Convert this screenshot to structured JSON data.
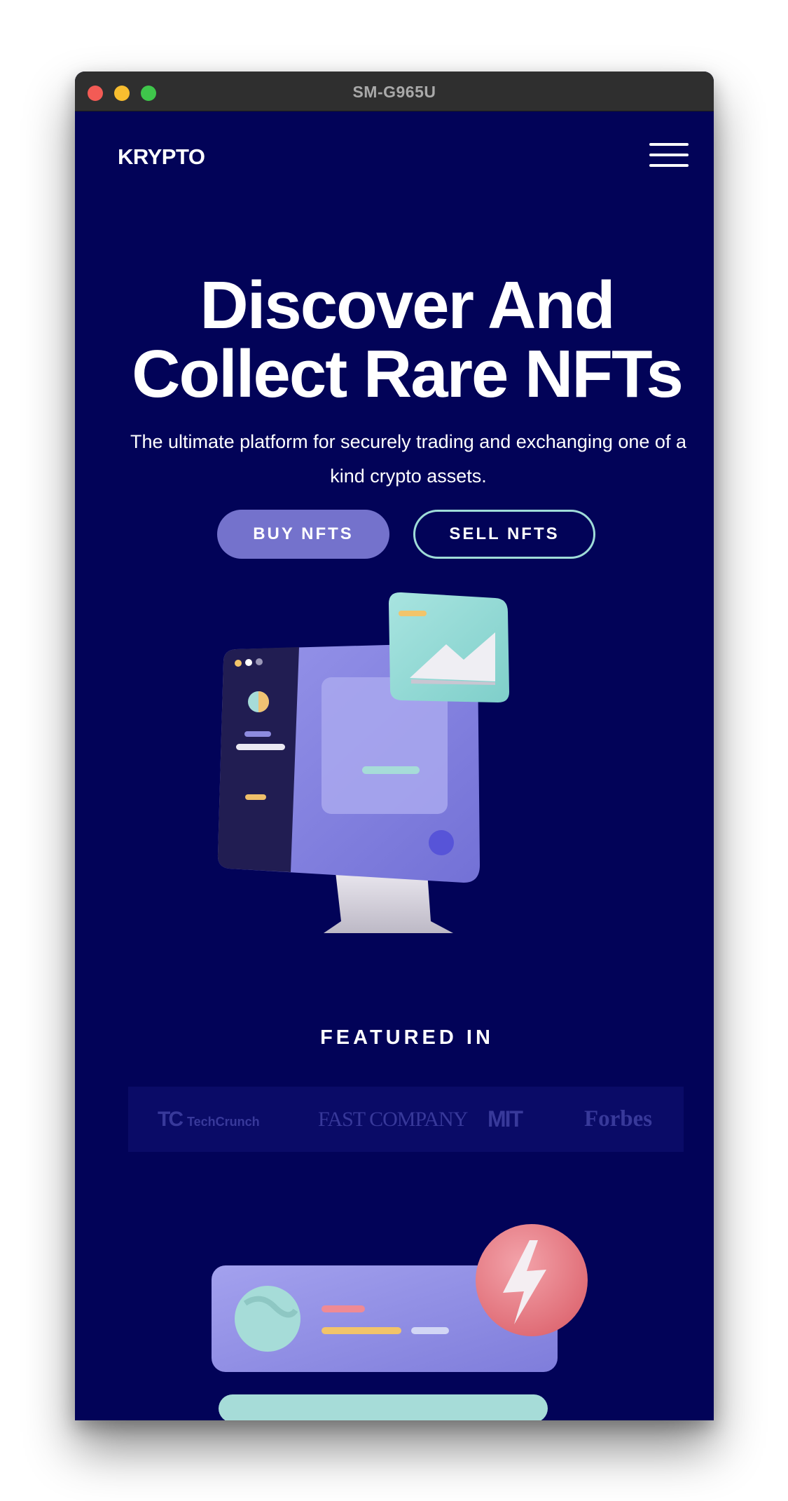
{
  "window": {
    "title": "SM-G965U"
  },
  "nav": {
    "logo": "KRYPTO",
    "menu_icon": "hamburger-menu-icon"
  },
  "hero": {
    "title_line1": "Discover And",
    "title_line2": "Collect Rare NFTs",
    "subtitle": "The ultimate platform for securely trading and exchanging one of a kind crypto assets.",
    "buy_label": "BUY NFTS",
    "sell_label": "SELL NFTS"
  },
  "featured": {
    "heading": "FEATURED IN",
    "logos": [
      {
        "name": "TechCrunch",
        "mark": "TC",
        "text": "TechCrunch"
      },
      {
        "name": "Fast Company",
        "text": "FAST COMPANY"
      },
      {
        "name": "MIT",
        "text": "MIT"
      },
      {
        "name": "Forbes",
        "text": "Forbes"
      }
    ]
  },
  "colors": {
    "background": "#020358",
    "buy_button": "#7472cc",
    "sell_border": "#9fdcd8",
    "titlebar": "#2f2f2f",
    "logo_strip": "#0a0b67"
  }
}
